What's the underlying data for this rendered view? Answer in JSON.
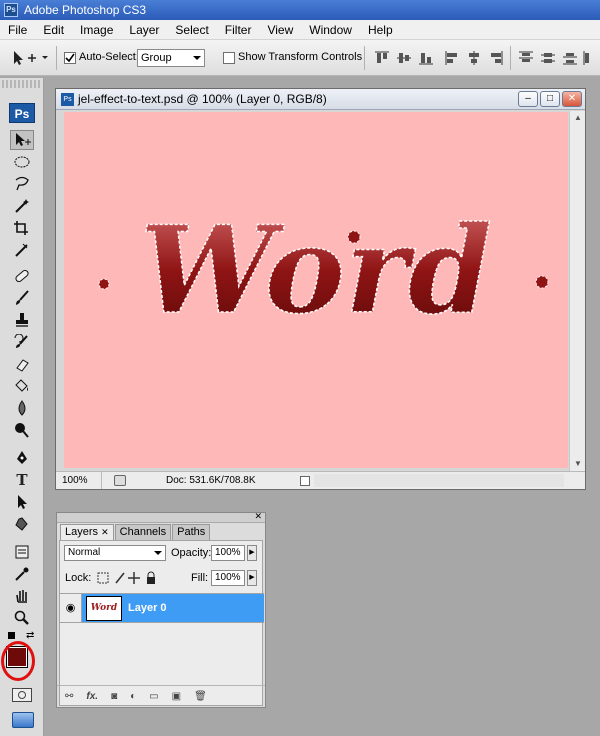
{
  "app": {
    "title": "Adobe Photoshop CS3",
    "logo_text": "Ps"
  },
  "menu": [
    "File",
    "Edit",
    "Image",
    "Layer",
    "Select",
    "Filter",
    "View",
    "Window",
    "Help"
  ],
  "options": {
    "auto_select_label": "Auto-Select:",
    "auto_select_checked": true,
    "auto_select_value": "Group",
    "transform_label": "Show Transform Controls",
    "transform_checked": false
  },
  "toolbox": {
    "logo": "Ps",
    "tools": [
      "move-tool-icon",
      "marquee-tool-icon",
      "lasso-tool-icon",
      "magic-wand-tool-icon",
      "crop-tool-icon",
      "slice-tool-icon",
      "healing-brush-icon",
      "brush-tool-icon",
      "clone-stamp-icon",
      "history-brush-icon",
      "eraser-icon",
      "paint-bucket-icon",
      "blur-tool-icon",
      "dodge-tool-icon",
      "pen-tool-icon",
      "type-tool-icon",
      "path-selection-icon",
      "custom-shape-icon",
      "notes-tool-icon",
      "eyedropper-icon",
      "hand-tool-icon",
      "zoom-tool-icon"
    ],
    "foreground_color": "#6e0a0a",
    "background_color": "#ffffff"
  },
  "document": {
    "title": "jel-effect-to-text.psd @ 100% (Layer 0, RGB/8)",
    "canvas_text": "Word",
    "canvas_bg": "#ffb8b8",
    "zoom": "100%",
    "doc_info": "Doc: 531.6K/708.8K",
    "window_buttons": [
      "–",
      "□",
      "✕"
    ]
  },
  "layers_panel": {
    "tabs": [
      "Layers",
      "Channels",
      "Paths"
    ],
    "blend_mode": "Normal",
    "opacity_label": "Opacity:",
    "opacity_value": "100%",
    "lock_label": "Lock:",
    "fill_label": "Fill:",
    "fill_value": "100%",
    "layer_name": "Layer 0",
    "thumb_text": "Word",
    "bottom_icons": [
      "link-layers-icon",
      "fx-icon",
      "mask-icon",
      "adjustment-layer-icon",
      "folder-icon",
      "new-layer-icon",
      "trash-icon"
    ]
  }
}
